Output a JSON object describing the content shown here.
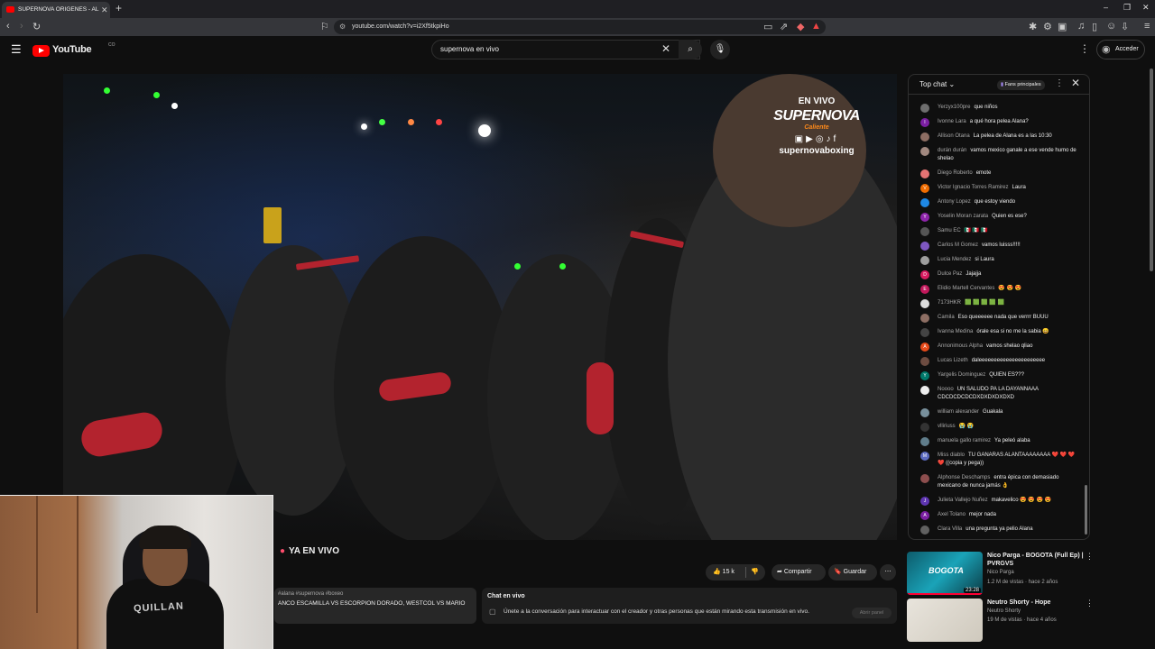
{
  "browser": {
    "tab_title": "SUPERNOVA ORIGENES - AL",
    "url": "youtube.com/watch?v=i2Xf5tkpiHo"
  },
  "youtube": {
    "logo_text": "YouTube",
    "logo_sup": "CO",
    "search_value": "supernova en vivo",
    "signin_label": "Acceder"
  },
  "video": {
    "overlay_live": "EN VIVO",
    "overlay_brand": "SUPERNOVA",
    "overlay_sub": "Caliente",
    "overlay_handle": "supernovaboxing",
    "title": "YA EN VIVO",
    "likes": "15 k",
    "share_label": "Compartir",
    "save_label": "Guardar",
    "desc_tags": "#alana #supernova #boxeo",
    "desc_text": "ANCO ESCAMILLA VS ESCORPION DORADO, WESTCOL VS MARIO"
  },
  "chat_box": {
    "title": "Chat en vivo",
    "text": "Únete a la conversación para interactuar con el creador y otras personas que están mirando esta transmisión en vivo.",
    "button": "Abrir panel"
  },
  "chat": {
    "mode": "Top chat",
    "fans_label": "Fans principales",
    "messages": [
      {
        "author": "Yerzyx100pre",
        "text": "que niños",
        "color": "#6e6e6e",
        "initial": ""
      },
      {
        "author": "Ivonne Lara",
        "text": "a qué hora pelea Alana?",
        "color": "#7b1fa2",
        "initial": "I"
      },
      {
        "author": "Allison Otana",
        "text": "La pelea de Alana es a las 10:30",
        "color": "#8d6e63",
        "initial": ""
      },
      {
        "author": "durán durán",
        "text": "vamos mexico ganale a ese vende humo de shelao",
        "color": "#a1887f",
        "initial": ""
      },
      {
        "author": "Diego Roberto",
        "text": "emote",
        "color": "#e57373",
        "initial": ""
      },
      {
        "author": "Victor Ignacio Torres Ramirez",
        "text": "Laura",
        "color": "#ef6c00",
        "initial": "V"
      },
      {
        "author": "Antony Lopez",
        "text": "que estoy viendo",
        "color": "#1e88e5",
        "initial": ""
      },
      {
        "author": "Yoselin Moran zarata",
        "text": "Quien es ese?",
        "color": "#8e24aa",
        "initial": "Y"
      },
      {
        "author": "Samu EC",
        "text": "🇲🇽 🇲🇽 🇲🇽",
        "color": "#555",
        "initial": ""
      },
      {
        "author": "Carlos M Gomez",
        "text": "vamos luisss!!!!!",
        "color": "#7e57c2",
        "initial": ""
      },
      {
        "author": "Lucia Mendez",
        "text": "si Laura",
        "color": "#9e9e9e",
        "initial": ""
      },
      {
        "author": "Dulce Paz",
        "text": "Jajajja",
        "color": "#d81b60",
        "initial": "D"
      },
      {
        "author": "Elidio Martell Cervantes",
        "text": "😍 😍 😍",
        "color": "#c2185b",
        "initial": "E"
      },
      {
        "author": "7173HKR",
        "text": "🟩 🟩 🟩 🟩 🟩",
        "color": "#ddd",
        "initial": ""
      },
      {
        "author": "Camila",
        "text": "Eso queeeeee nada que verrrr BUUU",
        "color": "#8d6e63",
        "initial": ""
      },
      {
        "author": "Ivanna Medina",
        "text": "órale esa si no me la sabia 😄",
        "color": "#444",
        "initial": ""
      },
      {
        "author": "Annonimous Alpha",
        "text": "vamos shelao qliao",
        "color": "#e64a19",
        "initial": "A"
      },
      {
        "author": "Lucas Lizeth",
        "text": "daleeeeeeeeeeeeeeeeeeeeee",
        "color": "#6d4c41",
        "initial": ""
      },
      {
        "author": "Yargelis Dominguez",
        "text": "QUIEN ES???",
        "color": "#00796b",
        "initial": "Y"
      },
      {
        "author": "Noooo",
        "text": "UN SALUDO PA LA DAYANNAAA CDCDCDCDCDXDXDXDXDXD",
        "color": "#eee",
        "initial": ""
      },
      {
        "author": "william alexander",
        "text": "Guakala",
        "color": "#78909c",
        "initial": ""
      },
      {
        "author": "vlliriuss",
        "text": "😭 😭",
        "color": "#333",
        "initial": ""
      },
      {
        "author": "manuela gallo ramirez",
        "text": "Ya peleó alaba",
        "color": "#607d8b",
        "initial": ""
      },
      {
        "author": "Miss diablo",
        "text": "TU GANARAS ALANTAAAAAAAA ❤️ ❤️ ❤️ ❤️ ((copia y pega))",
        "color": "#5c6bc0",
        "initial": "M"
      },
      {
        "author": "Alphonse Deschamps",
        "text": "entra épica con demasiado mexicano de nunca jamás 👌",
        "color": "#8d4e4e",
        "initial": ""
      },
      {
        "author": "Julieta Vallejo Nuñez",
        "text": "makavelico 😍 😍 😍 😍",
        "color": "#5e35b1",
        "initial": "J"
      },
      {
        "author": "Axel Tolano",
        "text": "mejor nada",
        "color": "#7b1fa2",
        "initial": "A"
      },
      {
        "author": "Clara Villa",
        "text": "una pregunta ya pelio Alana",
        "color": "#616161",
        "initial": ""
      }
    ]
  },
  "recommendations": [
    {
      "title": "Nico Parga - BOGOTA (Full Ep) | PVRGVS",
      "channel": "Nico Parga",
      "meta": "1.2 M de vistas · hace 2 años",
      "duration": "23:28",
      "thumb_text": "BOGOTA"
    },
    {
      "title": "Neutro Shorty - Hope",
      "channel": "Neutro Shorty",
      "meta": "19 M de vistas · hace 4 años",
      "duration": "",
      "thumb_text": ""
    }
  ],
  "webcam": {
    "shirt_text": "QUILLAN"
  }
}
